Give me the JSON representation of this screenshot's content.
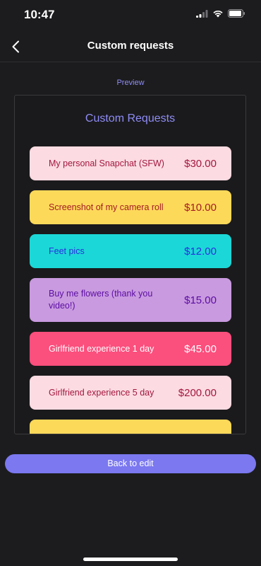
{
  "status_bar": {
    "time": "10:47"
  },
  "nav": {
    "title": "Custom requests"
  },
  "preview": {
    "label": "Preview",
    "card_title": "Custom Requests",
    "items": [
      {
        "label": "My personal Snapchat (SFW)",
        "price": "$30.00",
        "bg": "#fcdbe2",
        "fg": "#a3173e"
      },
      {
        "label": "Screenshot of my camera roll",
        "price": "$10.00",
        "bg": "#fdd95a",
        "fg": "#a31c24"
      },
      {
        "label": "Feet pics",
        "price": "$12.00",
        "bg": "#1cd7d7",
        "fg": "#2a2ee0"
      },
      {
        "label": "Buy me flowers (thank you video!)",
        "price": "$15.00",
        "bg": "#c99adf",
        "fg": "#5b0da3"
      },
      {
        "label": "Girlfriend experience 1 day",
        "price": "$45.00",
        "bg": "#fb4f7d",
        "fg": "#ffffff"
      },
      {
        "label": "Girlfriend experience 5 day",
        "price": "$200.00",
        "bg": "#fcdbe2",
        "fg": "#a3173e"
      }
    ]
  },
  "footer": {
    "back_to_edit": "Back to edit"
  },
  "colors": {
    "accent": "#7b78f0",
    "background": "#1c1c1e"
  }
}
